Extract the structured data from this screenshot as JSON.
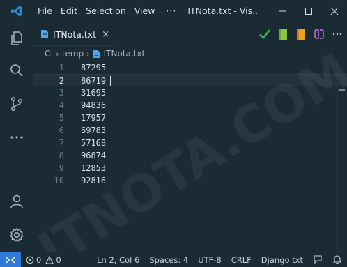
{
  "titlebar": {
    "menu": [
      "File",
      "Edit",
      "Selection",
      "View"
    ],
    "more": "···",
    "title": "ITNota.txt - Vis..."
  },
  "tab": {
    "label": "ITNota.txt",
    "close": "×"
  },
  "breadcrumb": [
    "C:",
    "temp",
    "ITNota.txt"
  ],
  "editor": {
    "lines": [
      {
        "n": "1",
        "text": "87295"
      },
      {
        "n": "2",
        "text": "86719"
      },
      {
        "n": "3",
        "text": "31695"
      },
      {
        "n": "4",
        "text": "94836"
      },
      {
        "n": "5",
        "text": "17957"
      },
      {
        "n": "6",
        "text": "69783"
      },
      {
        "n": "7",
        "text": "57168"
      },
      {
        "n": "8",
        "text": "96874"
      },
      {
        "n": "9",
        "text": "12853"
      },
      {
        "n": "10",
        "text": "92816"
      }
    ],
    "active_line": 2
  },
  "statusbar": {
    "remote": "><",
    "errors": "0",
    "warnings": "0",
    "position": "Ln 2, Col 6",
    "spaces": "Spaces: 4",
    "encoding": "UTF-8",
    "eol": "CRLF",
    "language": "Django txt"
  },
  "watermark": "ITNOTA.COM",
  "colors": {
    "background": "#1b2b34",
    "accent": "#2f7ad6",
    "check": "#3fb950",
    "book_green": "#8cc63f",
    "book_orange": "#f0a21a",
    "split": "#c678dd"
  }
}
